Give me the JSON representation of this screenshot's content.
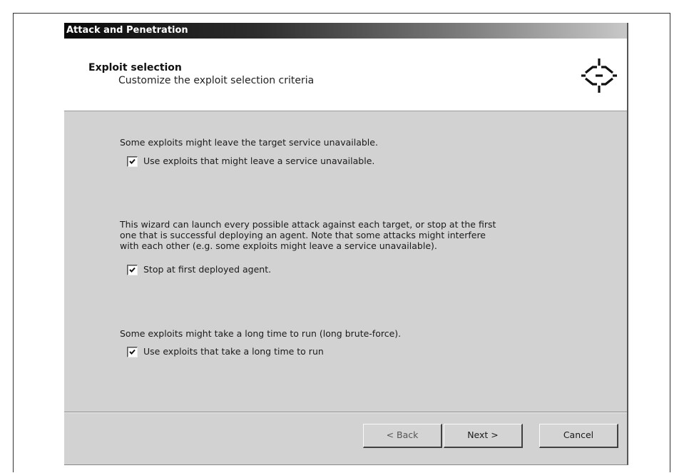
{
  "window": {
    "title": "Attack and Penetration"
  },
  "header": {
    "title": "Exploit selection",
    "subtitle": "Customize the exploit selection criteria",
    "icon": "target-crosshair-icon"
  },
  "sections": [
    {
      "text_lines": [
        "Some exploits might leave the target service unavailable."
      ],
      "checkbox": {
        "label": "Use exploits that might leave a service unavailable.",
        "checked": true
      }
    },
    {
      "text_lines": [
        "This wizard can launch every possible attack against each target, or stop at the first",
        "one that is successful deploying an agent. Note that some attacks might interfere",
        "with each other (e.g. some exploits might leave a service unavailable)."
      ],
      "checkbox": {
        "label": "Stop at first deployed agent.",
        "checked": true
      }
    },
    {
      "text_lines": [
        "Some exploits might take a long time to run (long brute-force)."
      ],
      "checkbox": {
        "label": "Use exploits that take a long time to run",
        "checked": true
      }
    }
  ],
  "buttons": {
    "back": "< Back",
    "next": "Next >",
    "cancel": "Cancel"
  }
}
